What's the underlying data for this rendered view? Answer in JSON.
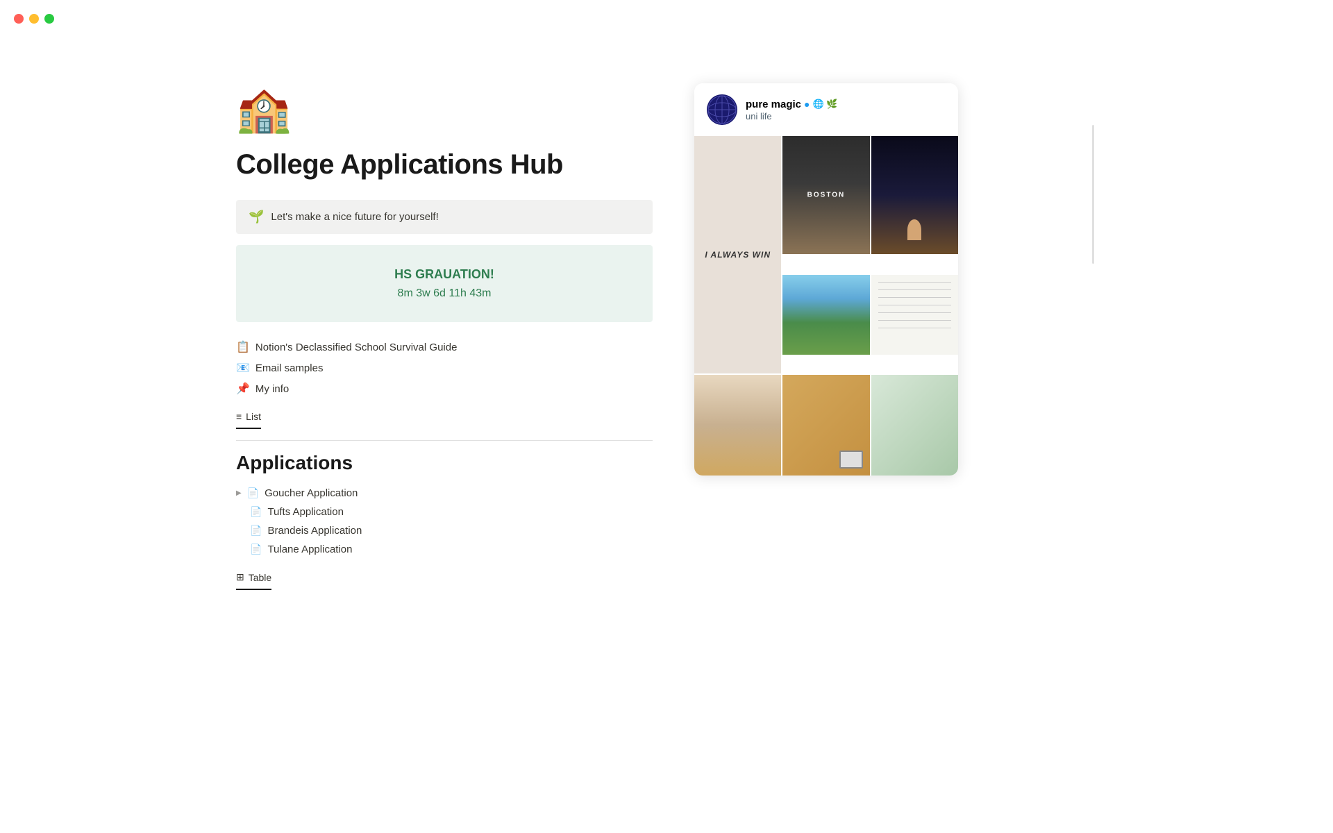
{
  "window": {
    "traffic_lights": {
      "red": "#ff5f57",
      "yellow": "#ffbd2e",
      "green": "#28ca41"
    }
  },
  "page": {
    "icon": "🏫",
    "title": "College Applications Hub",
    "callout": {
      "icon": "🌱",
      "text": "Let's make a nice future for yourself!"
    },
    "countdown": {
      "title": "HS GRAUATION!",
      "time": "8m 3w 6d 11h 43m"
    },
    "links": [
      {
        "icon": "📋",
        "text": "Notion's Declassified School Survival Guide"
      },
      {
        "icon": "📧",
        "text": "Email samples"
      },
      {
        "icon": "📌",
        "text": "My info"
      }
    ],
    "list_toggle": {
      "icon": "≡",
      "label": "List"
    },
    "applications_section": {
      "title": "Applications",
      "items": [
        {
          "name": "Goucher Application",
          "expanded": true,
          "indent": false
        },
        {
          "name": "Tufts Application",
          "indent": true
        },
        {
          "name": "Brandeis Application",
          "indent": true
        },
        {
          "name": "Tulane Application",
          "indent": true
        }
      ]
    },
    "table_toggle": {
      "icon": "⊞",
      "label": "Table"
    }
  },
  "social_card": {
    "name": "pure magic",
    "verified": true,
    "badges": "🌐 🌿",
    "subtitle": "uni life",
    "photos": {
      "always_win_text": "I ALWAYS WIN"
    }
  }
}
